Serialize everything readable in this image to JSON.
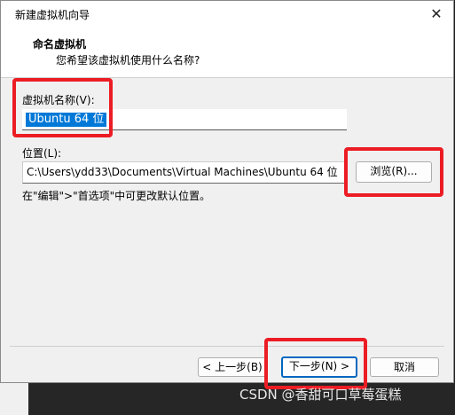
{
  "window": {
    "title": "新建虚拟机向导",
    "close_glyph": "✕"
  },
  "header": {
    "title": "命名虚拟机",
    "subtitle": "您希望该虚拟机使用什么名称?"
  },
  "form": {
    "name_label": "虚拟机名称(V):",
    "name_value": "Ubuntu 64 位",
    "location_label": "位置(L):",
    "location_value": "C:\\Users\\ydd33\\Documents\\Virtual Machines\\Ubuntu 64 位",
    "browse_label": "浏览(R)...",
    "hint": "在\"编辑\">\"首选项\"中可更改默认位置。"
  },
  "footer": {
    "back_label": "< 上一步(B)",
    "next_label": "下一步(N) >",
    "cancel_label": "取消"
  },
  "watermark": "CSDN @香甜可口草莓蛋糕",
  "colors": {
    "highlight": "#ec1c24",
    "selection": "#0078d7",
    "primary_border": "#0067c0"
  }
}
